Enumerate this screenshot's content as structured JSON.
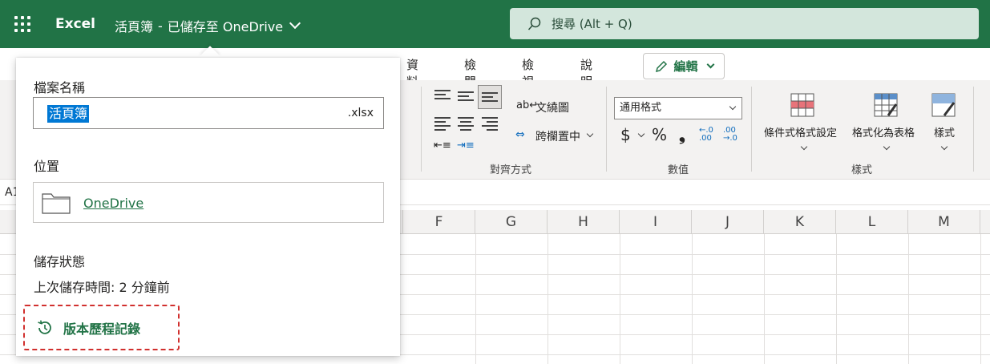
{
  "titlebar": {
    "app_name": "Excel",
    "doc_name": "活頁簿",
    "separator": "-",
    "save_status": "已儲存至 OneDrive",
    "search_placeholder": "搜尋 (Alt + Q)"
  },
  "ribbon": {
    "tabs": [
      {
        "label": "資料"
      },
      {
        "label": "檢閱"
      },
      {
        "label": "檢視"
      },
      {
        "label": "說明"
      }
    ],
    "edit_button": "編輯",
    "alignment": {
      "wrap_text": "文繞圖",
      "merge_center": "跨欄置中",
      "group_label": "對齊方式"
    },
    "number": {
      "format_value": "通用格式",
      "currency": "$",
      "percent": "%",
      "comma": "❟",
      "inc_decimal": "←.0 .00",
      "dec_decimal": ".00 →.0",
      "group_label": "數值"
    },
    "styles": {
      "conditional": "條件式格式設定",
      "format_table": "格式化為表格",
      "cell_styles": "樣式",
      "group_label": "樣式"
    }
  },
  "formula_bar": {
    "namebox": "A1"
  },
  "grid": {
    "columns": [
      "F",
      "G",
      "H",
      "I",
      "J",
      "K",
      "L",
      "M"
    ]
  },
  "file_panel": {
    "filename_label": "檔案名稱",
    "filename_value": "活頁簿",
    "extension": ".xlsx",
    "location_label": "位置",
    "location_value": "OneDrive",
    "save_status_label": "儲存狀態",
    "last_saved": "上次儲存時間: 2 分鐘前",
    "version_history": "版本歷程記錄"
  },
  "colors": {
    "brand": "#217346",
    "highlight_border": "#d1302e",
    "selection": "#0078d4"
  }
}
